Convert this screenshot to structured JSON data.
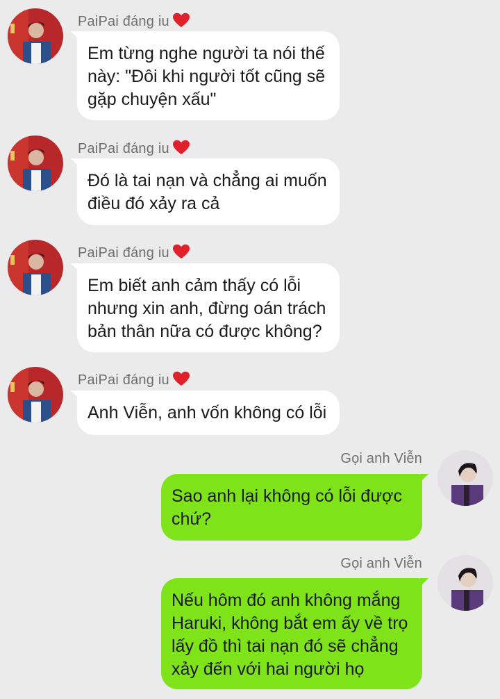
{
  "conversation": {
    "messages": [
      {
        "sender": "PaiPai đáng iu",
        "lines": [
          "Em từng nghe người ta nói thế",
          "này: \"Đôi khi người tốt cũng sẽ",
          "gặp chuyện xấu\""
        ]
      },
      {
        "sender": "PaiPai đáng iu",
        "lines": [
          "Đó là tai nạn và chẳng ai muốn",
          "điều đó xảy ra cả"
        ]
      },
      {
        "sender": "PaiPai đáng iu",
        "lines": [
          "Em biết anh cảm thấy có lỗi",
          "nhưng xin anh, đừng oán trách",
          "bản thân nữa có được không?"
        ]
      },
      {
        "sender": "PaiPai đáng iu",
        "lines": [
          "Anh Viễn, anh vốn không có lỗi"
        ]
      },
      {
        "sender": "Gọi anh Viễn",
        "lines": [
          "Sao anh lại không có lỗi được",
          "chứ?"
        ]
      },
      {
        "sender": "Gọi anh Viễn",
        "lines": [
          "Nếu hôm đó anh không mắng",
          "Haruki, không bắt em ấy về trọ",
          "lấy đồ thì tai nạn đó sẽ chẳng",
          "xảy đến với hai người họ"
        ]
      }
    ]
  },
  "colors": {
    "background": "#ebebeb",
    "incoming_bubble": "#ffffff",
    "outgoing_bubble": "#7fe31a",
    "name_text": "#6f6f6f",
    "heart": "#e0202a"
  },
  "icons": {
    "heart": "heart-icon",
    "avatar_left": "avatar-paipai",
    "avatar_right": "avatar-vien"
  }
}
